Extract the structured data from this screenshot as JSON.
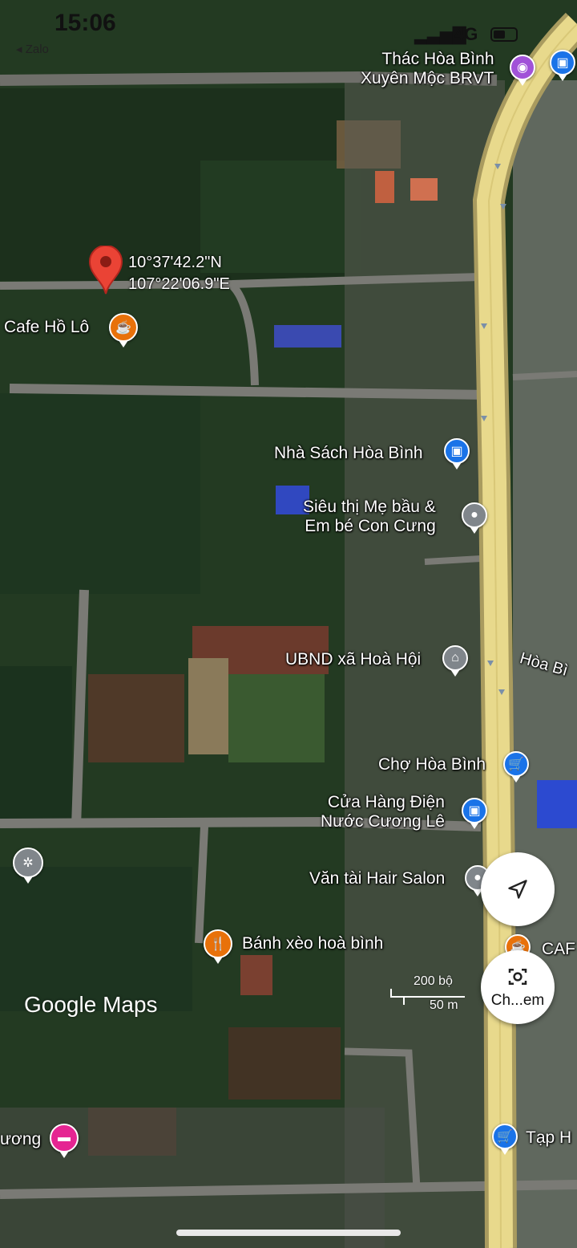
{
  "status_bar": {
    "time": "15:06",
    "back_label": "◂ Zalo",
    "network": "4G"
  },
  "dropped_pin": {
    "lat": "10°37'42.2\"N",
    "lng": "107°22'06.9\"E"
  },
  "places": [
    {
      "name": "Thác Hòa Bình\nXuyên Mộc BRVT",
      "icon": "camera-icon",
      "color": "#a152d8"
    },
    {
      "name": "Cafe Hồ Lô",
      "icon": "coffee-icon",
      "color": "#e8710a"
    },
    {
      "name": "Nhà Sách Hòa Bình",
      "icon": "shopping-bag-icon",
      "color": "#1a73e8"
    },
    {
      "name": "Siêu thị Mẹ bầu &\nEm bé Con Cưng",
      "icon": "place-icon",
      "color": "#80868b"
    },
    {
      "name": "UBND xã Hoà Hội",
      "icon": "government-icon",
      "color": "#80868b"
    },
    {
      "name": "Chợ Hòa Bình",
      "icon": "shopping-cart-icon",
      "color": "#1a73e8"
    },
    {
      "name": "Cửa Hàng Điện\nNước Cương Lê",
      "icon": "shopping-bag-icon",
      "color": "#1a73e8"
    },
    {
      "name": "Văn tài Hair Salon",
      "icon": "place-icon",
      "color": "#80868b"
    },
    {
      "name": "Bánh xèo hoà bình",
      "icon": "restaurant-icon",
      "color": "#e8710a"
    },
    {
      "name": "CAF",
      "icon": "coffee-icon",
      "color": "#e8710a"
    },
    {
      "name": "ương",
      "icon": "hotel-icon",
      "color": "#e52592"
    },
    {
      "name": "Tạp H",
      "icon": "shopping-cart-icon",
      "color": "#1a73e8"
    }
  ],
  "road_label": "Hòa Bì",
  "scale": {
    "top": "200 bộ",
    "bottom": "50 m"
  },
  "logo": "Google Maps",
  "buttons": {
    "locate": "my-location-icon",
    "lens_label": "Ch...em"
  }
}
